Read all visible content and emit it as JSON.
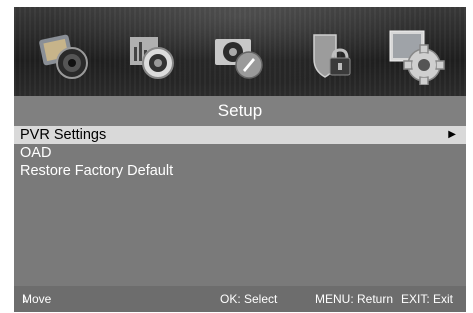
{
  "header": {
    "title": "Setup"
  },
  "icons": [
    "picture-icon",
    "sound-icon",
    "channel-icon",
    "lock-icon",
    "setup-gear-icon"
  ],
  "menu": {
    "items": [
      {
        "label": "PVR Settings",
        "selected": true
      },
      {
        "label": "OAD",
        "selected": false
      },
      {
        "label": "Restore Factory Default",
        "selected": false
      }
    ]
  },
  "footer": {
    "move": "Move",
    "select": "OK: Select",
    "return": "MENU: Return",
    "exit": "EXIT: Exit"
  },
  "colors": {
    "menu_bg": "#7a7a7a",
    "title_bg": "#808080",
    "selected_bg": "#d9d9d9",
    "footer_bg": "#6d6d6d"
  }
}
